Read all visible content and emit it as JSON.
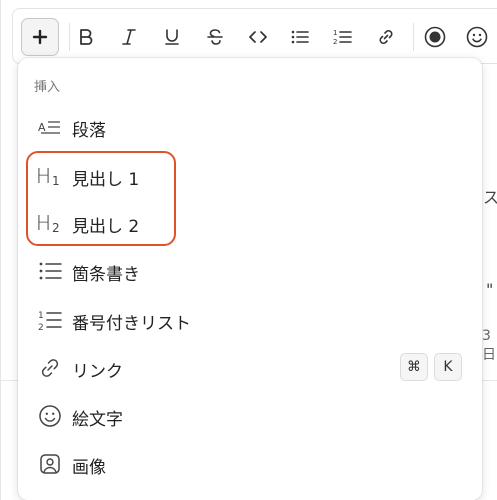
{
  "toolbar": {
    "items": [
      {
        "name": "insert",
        "icon": "plus-icon"
      },
      {
        "name": "bold",
        "icon": "bold-icon"
      },
      {
        "name": "italic",
        "icon": "italic-icon"
      },
      {
        "name": "underline",
        "icon": "underline-icon"
      },
      {
        "name": "strikethrough",
        "icon": "strikethrough-icon"
      },
      {
        "name": "code",
        "icon": "code-icon"
      },
      {
        "name": "bulleted-list",
        "icon": "bulleted-list-icon"
      },
      {
        "name": "numbered-list",
        "icon": "numbered-list-icon"
      },
      {
        "name": "link",
        "icon": "link-icon"
      },
      {
        "name": "record",
        "icon": "record-icon"
      },
      {
        "name": "emoji",
        "icon": "smiley-icon"
      }
    ]
  },
  "menu": {
    "section_label": "挿入",
    "items": [
      {
        "label": "段落",
        "icon": "paragraph-icon"
      },
      {
        "label": "見出し 1",
        "icon": "heading-1-icon"
      },
      {
        "label": "見出し 2",
        "icon": "heading-2-icon"
      },
      {
        "label": "箇条書き",
        "icon": "bulleted-list-icon"
      },
      {
        "label": "番号付きリスト",
        "icon": "numbered-list-icon"
      },
      {
        "label": "リンク",
        "icon": "link-icon",
        "shortcut": [
          "⌘",
          "K"
        ]
      },
      {
        "label": "絵文字",
        "icon": "smiley-icon"
      },
      {
        "label": "画像",
        "icon": "image-icon"
      }
    ]
  },
  "background": {
    "fragments": [
      "ス",
      "\"",
      "3日"
    ]
  },
  "colors": {
    "highlight": "#e0532a"
  }
}
